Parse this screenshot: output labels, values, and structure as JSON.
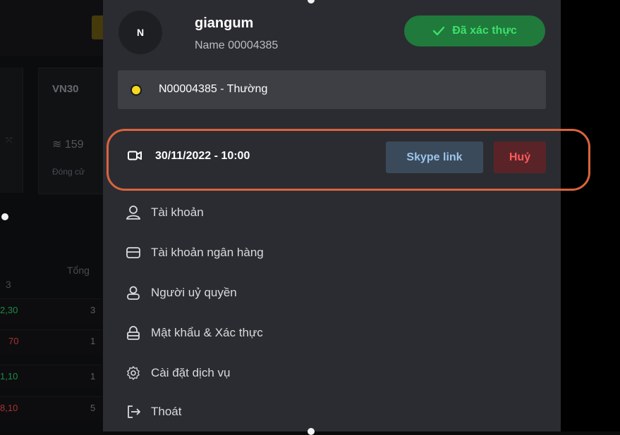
{
  "background": {
    "vn30_label": "VN30",
    "index_value": "159",
    "closing_label": "Đóng cử",
    "total_label": "Tổng",
    "col_label": "3",
    "rows": [
      {
        "left": "2,30",
        "left_color": "#2fd36b",
        "right": "3"
      },
      {
        "left": "70",
        "left_color": "#ff4d4d",
        "right": "1"
      },
      {
        "left": "1,10",
        "left_color": "#2fd36b",
        "right": "1"
      },
      {
        "left": "8,10",
        "left_color": "#ff4d4d",
        "right": "5"
      }
    ]
  },
  "user": {
    "avatar_initial": "N",
    "username": "giangum",
    "full_name": "Name 00004385",
    "verified_label": "Đã xác thực"
  },
  "account": {
    "label": "N00004385 - Thường",
    "status_color": "#f7d91f"
  },
  "appointment": {
    "datetime": "30/11/2022 - 10:00",
    "skype_label": "Skype link",
    "cancel_label": "Huỷ"
  },
  "menu": {
    "items": [
      {
        "label": "Tài khoản",
        "icon": "user-icon"
      },
      {
        "label": "Tài khoản ngân hàng",
        "icon": "credit-card-icon"
      },
      {
        "label": "Người uỷ quyền",
        "icon": "delegate-icon"
      },
      {
        "label": "Mật khẩu & Xác thực",
        "icon": "lock-icon"
      },
      {
        "label": "Cài đặt dịch vụ",
        "icon": "gear-icon"
      },
      {
        "label": "Thoát",
        "icon": "logout-icon"
      }
    ]
  },
  "colors": {
    "panel_bg": "#2b2c31",
    "highlight_border": "#d9643d",
    "verified_bg": "#1f7a3c",
    "verified_text": "#3ee06a",
    "cancel_text": "#ff5a5a"
  }
}
